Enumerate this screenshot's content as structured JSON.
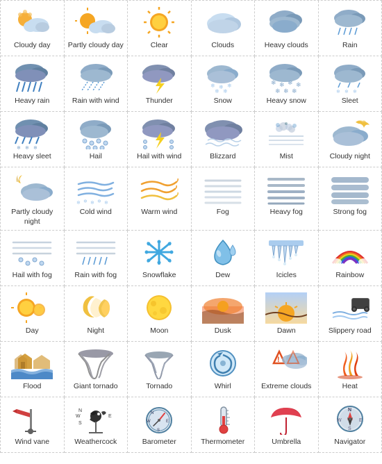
{
  "icons": [
    {
      "name": "cloudy-day",
      "label": "Cloudy day",
      "emoji": "🌤"
    },
    {
      "name": "partly-cloudy-day",
      "label": "Partly cloudy day",
      "emoji": "⛅"
    },
    {
      "name": "clear",
      "label": "Clear",
      "emoji": "☀️"
    },
    {
      "name": "clouds",
      "label": "Clouds",
      "emoji": "☁️"
    },
    {
      "name": "heavy-clouds",
      "label": "Heavy clouds",
      "emoji": "🌧"
    },
    {
      "name": "rain",
      "label": "Rain",
      "emoji": "🌧"
    },
    {
      "name": "heavy-rain",
      "label": "Heavy rain",
      "emoji": "🌧"
    },
    {
      "name": "rain-with-wind",
      "label": "Rain with wind",
      "emoji": "🌬🌧"
    },
    {
      "name": "thunder",
      "label": "Thunder",
      "emoji": "⛈"
    },
    {
      "name": "snow",
      "label": "Snow",
      "emoji": "🌨"
    },
    {
      "name": "heavy-snow",
      "label": "Heavy snow",
      "emoji": "❄️"
    },
    {
      "name": "sleet",
      "label": "Sleet",
      "emoji": "🌧❄"
    },
    {
      "name": "heavy-sleet",
      "label": "Heavy sleet",
      "emoji": "🌧❄"
    },
    {
      "name": "hail",
      "label": "Hail",
      "emoji": "🌨"
    },
    {
      "name": "hail-with-wind",
      "label": "Hail with wind",
      "emoji": "💨🌨"
    },
    {
      "name": "blizzard",
      "label": "Blizzard",
      "emoji": "🌬❄"
    },
    {
      "name": "mist",
      "label": "Mist",
      "emoji": "🌫"
    },
    {
      "name": "cloudy-night",
      "label": "Cloudy night",
      "emoji": "🌙☁"
    },
    {
      "name": "partly-cloudy-night",
      "label": "Partly cloudy night",
      "emoji": "🌙⛅"
    },
    {
      "name": "cold-wind",
      "label": "Cold wind",
      "emoji": "🌬"
    },
    {
      "name": "warm-wind",
      "label": "Warm wind",
      "emoji": "💨"
    },
    {
      "name": "fog",
      "label": "Fog",
      "emoji": "🌁"
    },
    {
      "name": "heavy-fog",
      "label": "Heavy fog",
      "emoji": "🌫"
    },
    {
      "name": "strong-fog",
      "label": "Strong fog",
      "emoji": "🌫"
    },
    {
      "name": "hail-with-fog",
      "label": "Hail with fog",
      "emoji": "🌨🌫"
    },
    {
      "name": "rain-with-fog",
      "label": "Rain with fog",
      "emoji": "🌧🌫"
    },
    {
      "name": "snowflake",
      "label": "Snowflake",
      "emoji": "❄️"
    },
    {
      "name": "dew",
      "label": "Dew",
      "emoji": "💧"
    },
    {
      "name": "icicles",
      "label": "Icicles",
      "emoji": "🧊"
    },
    {
      "name": "rainbow",
      "label": "Rainbow",
      "emoji": "🌈"
    },
    {
      "name": "day",
      "label": "Day",
      "emoji": "☀️"
    },
    {
      "name": "night",
      "label": "Night",
      "emoji": "🌙"
    },
    {
      "name": "moon",
      "label": "Moon",
      "emoji": "🌕"
    },
    {
      "name": "dusk",
      "label": "Dusk",
      "emoji": "🌅"
    },
    {
      "name": "dawn",
      "label": "Dawn",
      "emoji": "🌄"
    },
    {
      "name": "slippery-road",
      "label": "Slippery road",
      "emoji": "🚗"
    },
    {
      "name": "flood",
      "label": "Flood",
      "emoji": "🏠💧"
    },
    {
      "name": "giant-tornado",
      "label": "Giant tornado",
      "emoji": "🌪"
    },
    {
      "name": "tornado",
      "label": "Tornado",
      "emoji": "🌪"
    },
    {
      "name": "whirl",
      "label": "Whirl",
      "emoji": "🌀"
    },
    {
      "name": "extreme-clouds",
      "label": "Extreme clouds",
      "emoji": "⚠️☁"
    },
    {
      "name": "heat",
      "label": "Heat",
      "emoji": "🔥"
    },
    {
      "name": "wind-vane",
      "label": "Wind vane",
      "emoji": "🚩"
    },
    {
      "name": "weathercock",
      "label": "Weathercock",
      "emoji": "🐓"
    },
    {
      "name": "barometer",
      "label": "Barometer",
      "emoji": "🕐"
    },
    {
      "name": "thermometer",
      "label": "Thermometer",
      "emoji": "🌡"
    },
    {
      "name": "umbrella",
      "label": "Umbrella",
      "emoji": "☂️"
    },
    {
      "name": "navigator",
      "label": "Navigator",
      "emoji": "🧭"
    }
  ]
}
